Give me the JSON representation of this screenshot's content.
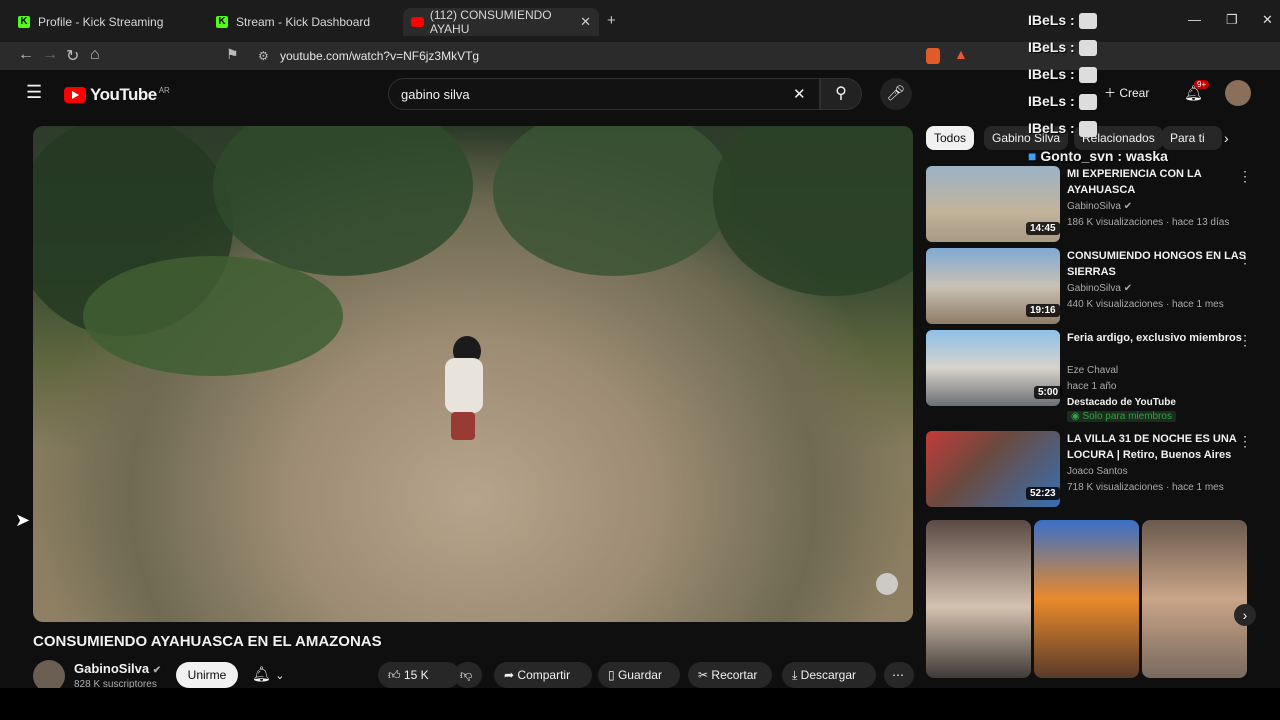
{
  "browser": {
    "tabs": [
      {
        "label": "Profile - Kick Streaming",
        "favicon": "kick-icon"
      },
      {
        "label": "Stream - Kick Dashboard",
        "favicon": "kick-icon"
      },
      {
        "label": "(112) CONSUMIENDO AYAHU",
        "favicon": "youtube-icon"
      }
    ],
    "url": "youtube.com/watch?v=NF6jz3MkVTg"
  },
  "youtube": {
    "logo_text": "YouTube",
    "country_code": "AR",
    "search_value": "gabino silva",
    "create_label": "Crear",
    "notification_count": "9+"
  },
  "video": {
    "title": "CONSUMIENDO AYAHUASCA EN EL AMAZONAS",
    "channel": "GabinoSilva",
    "subscribers": "828 K suscriptores",
    "join_label": "Unirme",
    "likes": "15 K",
    "share_label": "Compartir",
    "save_label": "Guardar",
    "clip_label": "Recortar",
    "download_label": "Descargar"
  },
  "chips": [
    "Todos",
    "Gabino Silva",
    "Relacionados",
    "Para ti"
  ],
  "recommendations": [
    {
      "title": "MI EXPERIENCIA CON LA AYAHUASCA",
      "channel": "GabinoSilva",
      "meta": "186 K visualizaciones · hace 13 días",
      "duration": "14:45"
    },
    {
      "title": "CONSUMIENDO HONGOS EN LAS SIERRAS",
      "channel": "GabinoSilva",
      "meta": "440 K visualizaciones · hace 1 mes",
      "duration": "19:16"
    },
    {
      "title": "Feria ardigo, exclusivo miembros",
      "channel": "Eze Chaval",
      "meta": "hace 1 año",
      "extra": "Destacado de YouTube",
      "badge": "Solo para miembros",
      "duration": "5:00"
    },
    {
      "title": "LA VILLA 31 DE NOCHE ES UNA LOCURA | Retiro, Buenos Aires",
      "channel": "Joaco Santos",
      "meta": "718 K visualizaciones · hace 1 mes",
      "duration": "52:23"
    }
  ],
  "chat": [
    {
      "user": "IBeLs :"
    },
    {
      "user": "IBeLs :"
    },
    {
      "user": "IBeLs :"
    },
    {
      "user": "IBeLs :"
    },
    {
      "user": "IBeLs :"
    },
    {
      "user": "Gonto_svn : waska"
    }
  ]
}
